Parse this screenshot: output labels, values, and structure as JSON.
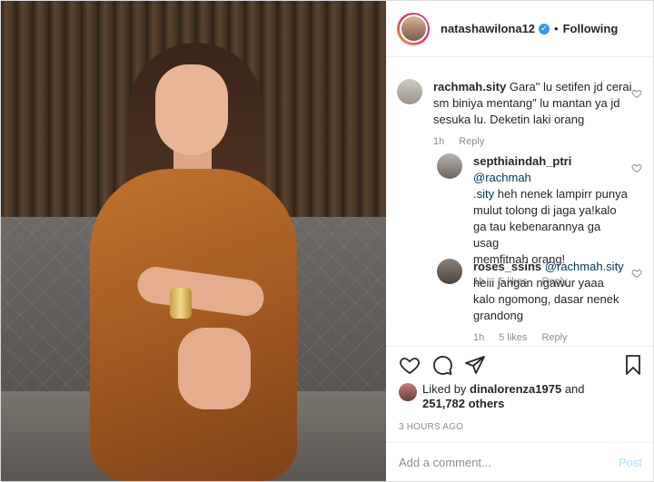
{
  "header": {
    "username": "natashawilona12",
    "separator": "•",
    "follow_status": "Following"
  },
  "comments": [
    {
      "user": "rachmah.sity",
      "text": "Gara\" lu setifen jd cerai sm biniya mentang\" lu mantan ya jd sesuka lu. Deketin laki orang",
      "lines": [
        "Gara\" lu setifen jd cerai",
        "sm biniya mentang\" lu mantan ya jd",
        "sesuka lu. Deketin laki orang"
      ],
      "time": "1h",
      "reply": "Reply"
    },
    {
      "user": "septhiaindah_ptri",
      "mention_a": "@rachmah",
      "mention_b": ".sity",
      "lines": [
        "heh nenek lampirr punya",
        "mulut tolong di jaga ya!kalo",
        "ga tau kebenarannya ga usag",
        "memfitnah orang!"
      ],
      "time": "1h",
      "likes": "5 likes",
      "reply": "Reply"
    },
    {
      "user": "roses_ssins",
      "mention": "@rachmah.sity",
      "lines": [
        "heiii jangan ngawur yaaa",
        "kalo ngomong, dasar nenek",
        "grandong"
      ],
      "time": "1h",
      "likes": "5 likes",
      "reply": "Reply"
    }
  ],
  "likes": {
    "prefix": "Liked by",
    "liker": "dinalorenza1975",
    "conj": "and",
    "others": "251,782 others"
  },
  "timestamp": "3 HOURS AGO",
  "add_comment": {
    "placeholder": "Add a comment...",
    "post_label": "Post"
  },
  "icons": {
    "like": "heart-icon",
    "comment": "comment-icon",
    "share": "share-icon",
    "save": "bookmark-icon",
    "verified": "verified-badge-icon"
  },
  "colors": {
    "verified": "#3897f0",
    "mention": "#003569",
    "muted": "#8e8e8e",
    "post_disabled": "#b3dbff"
  }
}
